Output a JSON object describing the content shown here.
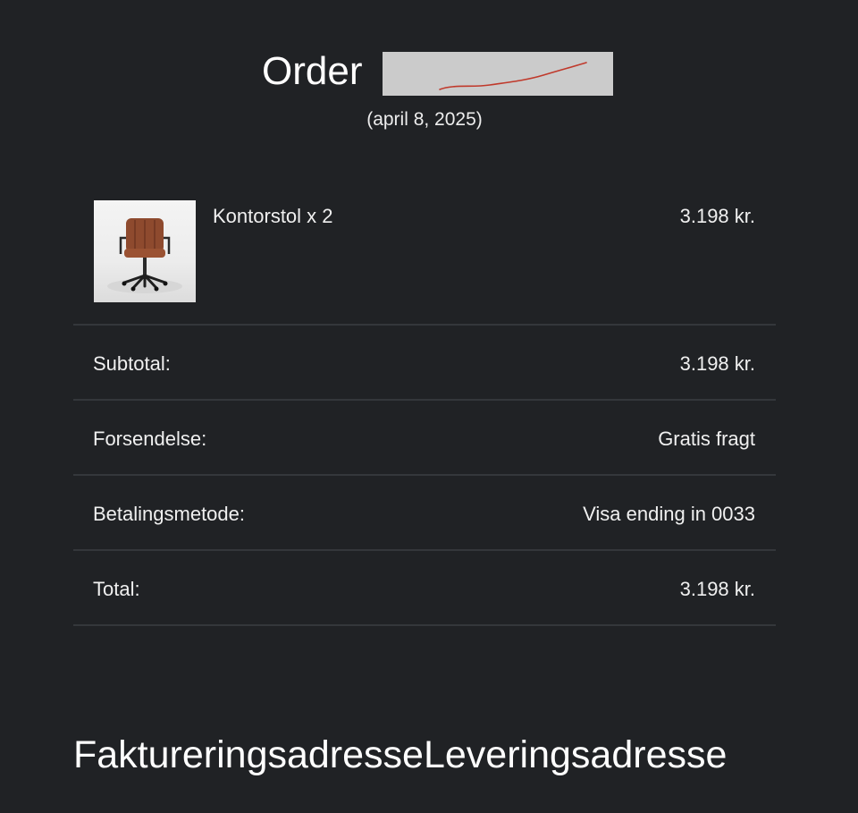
{
  "order": {
    "title": "Order",
    "date": "(april 8, 2025)"
  },
  "item": {
    "name": "Kontorstol x 2",
    "price": "3.198 kr.",
    "image": "office-chair-thumbnail"
  },
  "summary": [
    {
      "label": "Subtotal:",
      "value": "3.198 kr."
    },
    {
      "label": "Forsendelse:",
      "value": "Gratis fragt"
    },
    {
      "label": "Betalingsmetode:",
      "value": "Visa ending in 0033"
    },
    {
      "label": "Total:",
      "value": "3.198 kr."
    }
  ],
  "addresses": {
    "billing_heading": "Faktureringsadresse",
    "shipping_heading": "Leveringsadresse"
  },
  "colors": {
    "background": "#202225",
    "divider": "#34373b",
    "redaction": "#cbcbcb",
    "scribble": "#c0392b"
  }
}
